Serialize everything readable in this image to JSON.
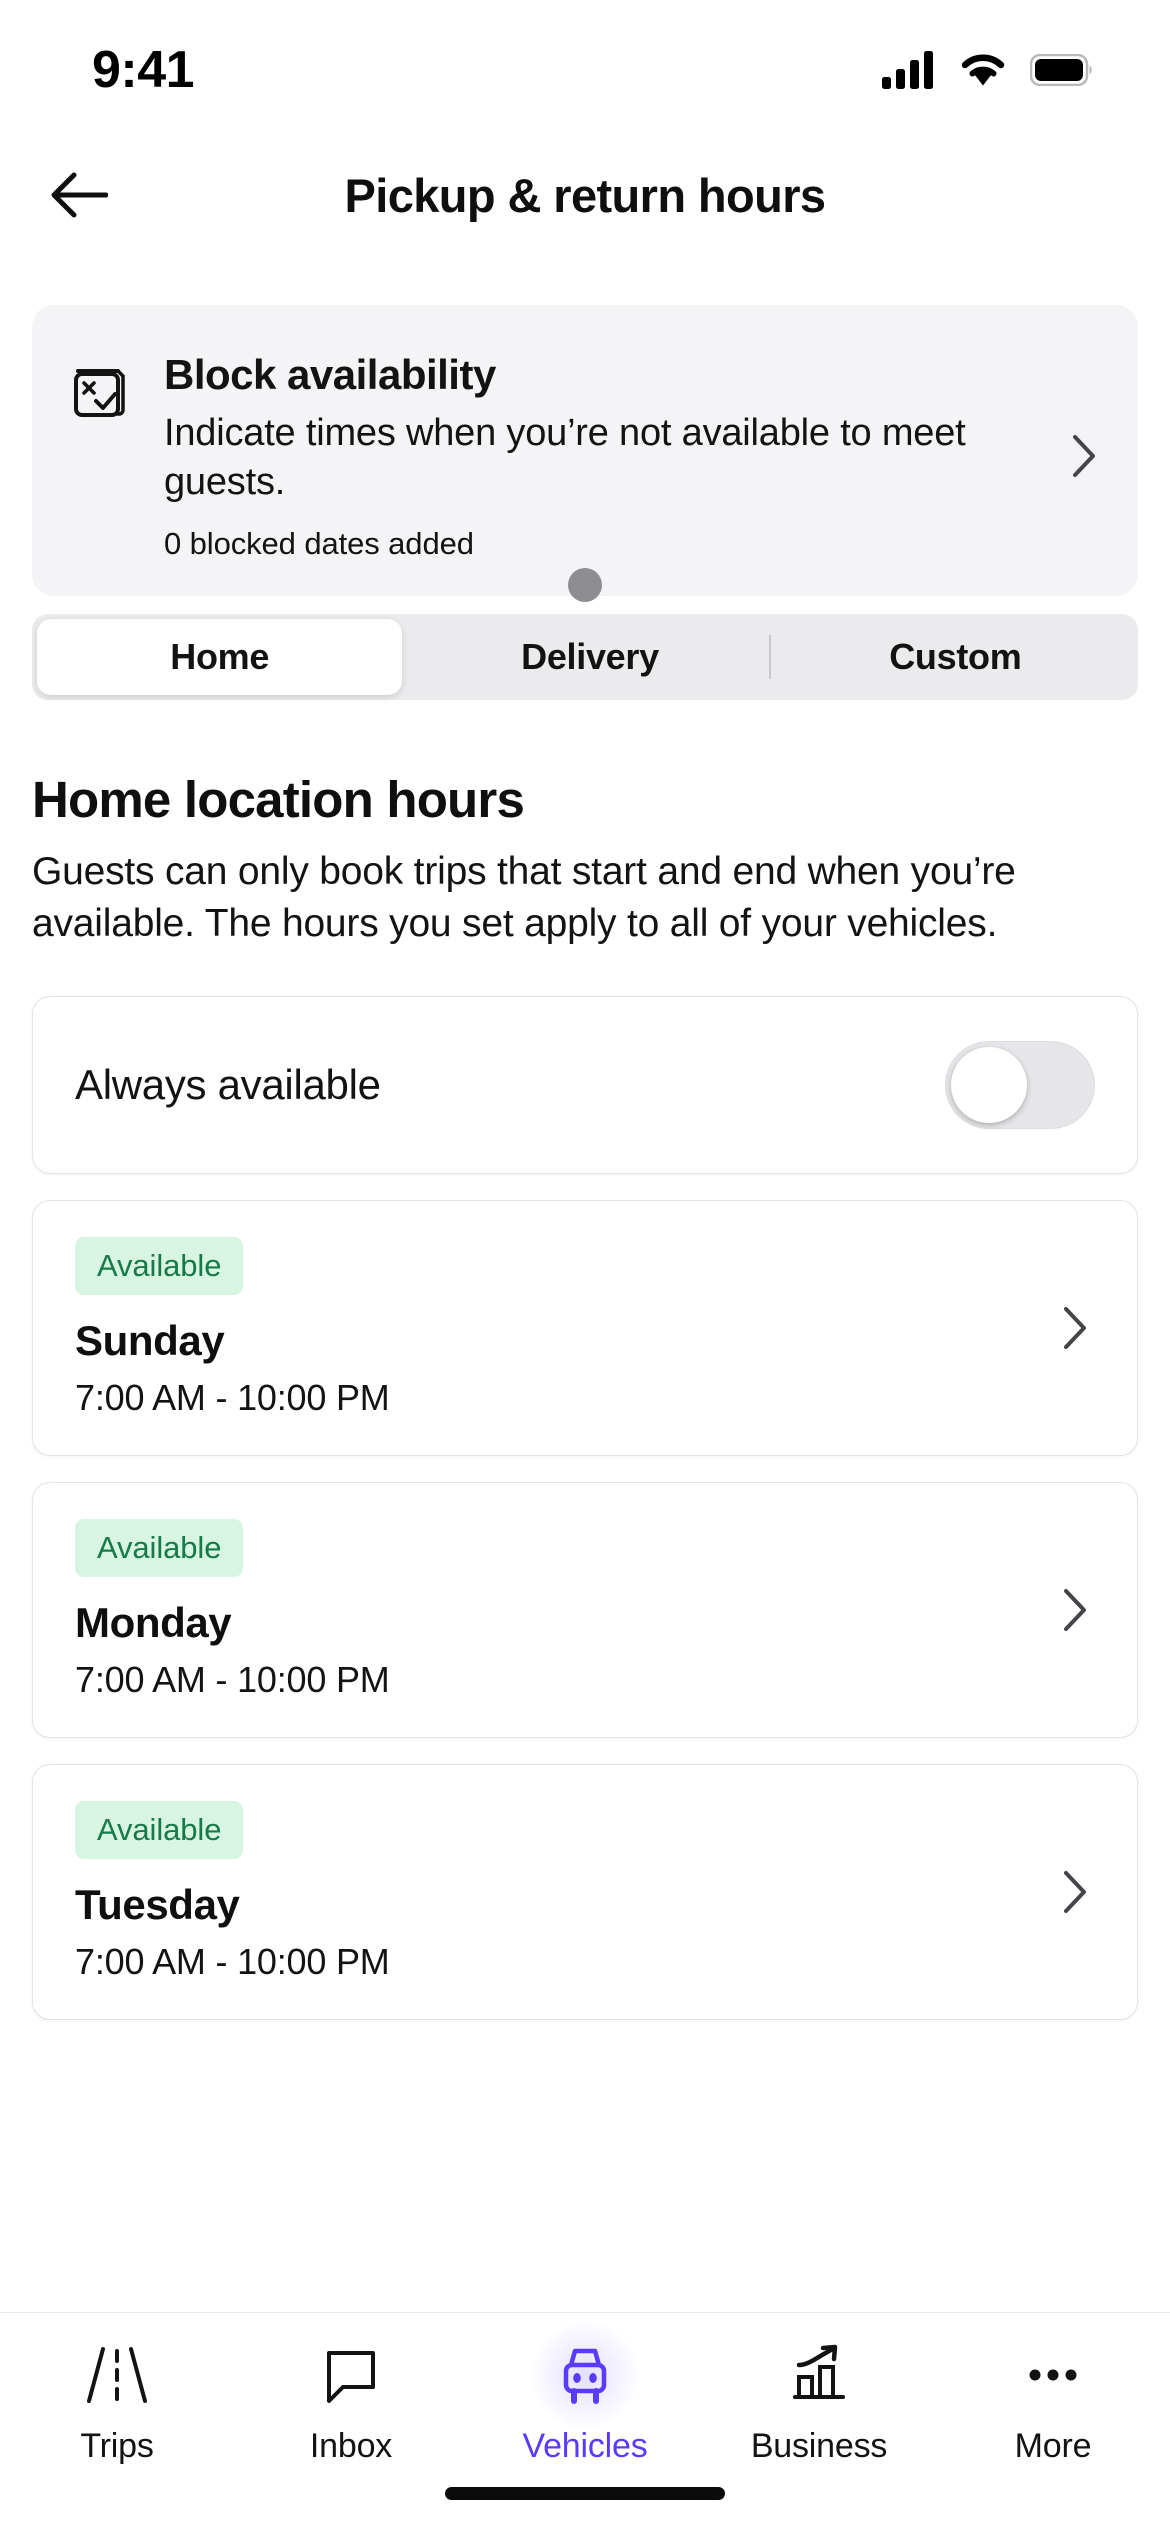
{
  "status_bar": {
    "time": "9:41",
    "signal_icon": "cellular-signal-icon",
    "wifi_icon": "wifi-icon",
    "battery_icon": "battery-icon"
  },
  "header": {
    "back_icon": "back-arrow-icon",
    "title": "Pickup & return hours"
  },
  "promo_card": {
    "icon": "blocked-calendar-icon",
    "title": "Block availability",
    "description": "Indicate times when you’re not available to meet guests.",
    "meta": "0 blocked dates added",
    "chevron_icon": "chevron-right-icon",
    "dot_count": 1,
    "dot_color": "#8d8d92"
  },
  "segmented_control": {
    "selected": "Home",
    "options": [
      {
        "label": "Home",
        "active": true
      },
      {
        "label": "Delivery",
        "active": false
      },
      {
        "label": "Custom",
        "active": false
      }
    ]
  },
  "section": {
    "title": "Home location hours",
    "description": "Guests can only book trips that start and end when you’re available. The hours you set apply to all of your vehicles."
  },
  "always_available": {
    "label": "Always available",
    "toggle_state": "off",
    "track_color": "#e6e5e8",
    "knob_color": "#ffffff"
  },
  "days": [
    {
      "badge": "Available",
      "name": "Sunday",
      "hours": "7:00 AM - 10:00 PM",
      "chevron_icon": "chevron-right-icon"
    },
    {
      "badge": "Available",
      "name": "Monday",
      "hours": "7:00 AM - 10:00 PM",
      "chevron_icon": "chevron-right-icon"
    },
    {
      "badge": "Available",
      "name": "Tuesday",
      "hours": "7:00 AM - 10:00 PM",
      "chevron_icon": "chevron-right-icon"
    }
  ],
  "badge_colors": {
    "background": "#d8f5e3",
    "text": "#167a4a"
  },
  "bottom_nav": {
    "active": "Vehicles",
    "accent_color": "#593cfb",
    "items": [
      {
        "label": "Trips",
        "icon": "road-icon",
        "active": false
      },
      {
        "label": "Inbox",
        "icon": "speech-bubble-icon",
        "active": false
      },
      {
        "label": "Vehicles",
        "icon": "car-icon",
        "active": true
      },
      {
        "label": "Business",
        "icon": "bar-chart-arrow-icon",
        "active": false
      },
      {
        "label": "More",
        "icon": "ellipsis-icon",
        "active": false
      }
    ]
  }
}
